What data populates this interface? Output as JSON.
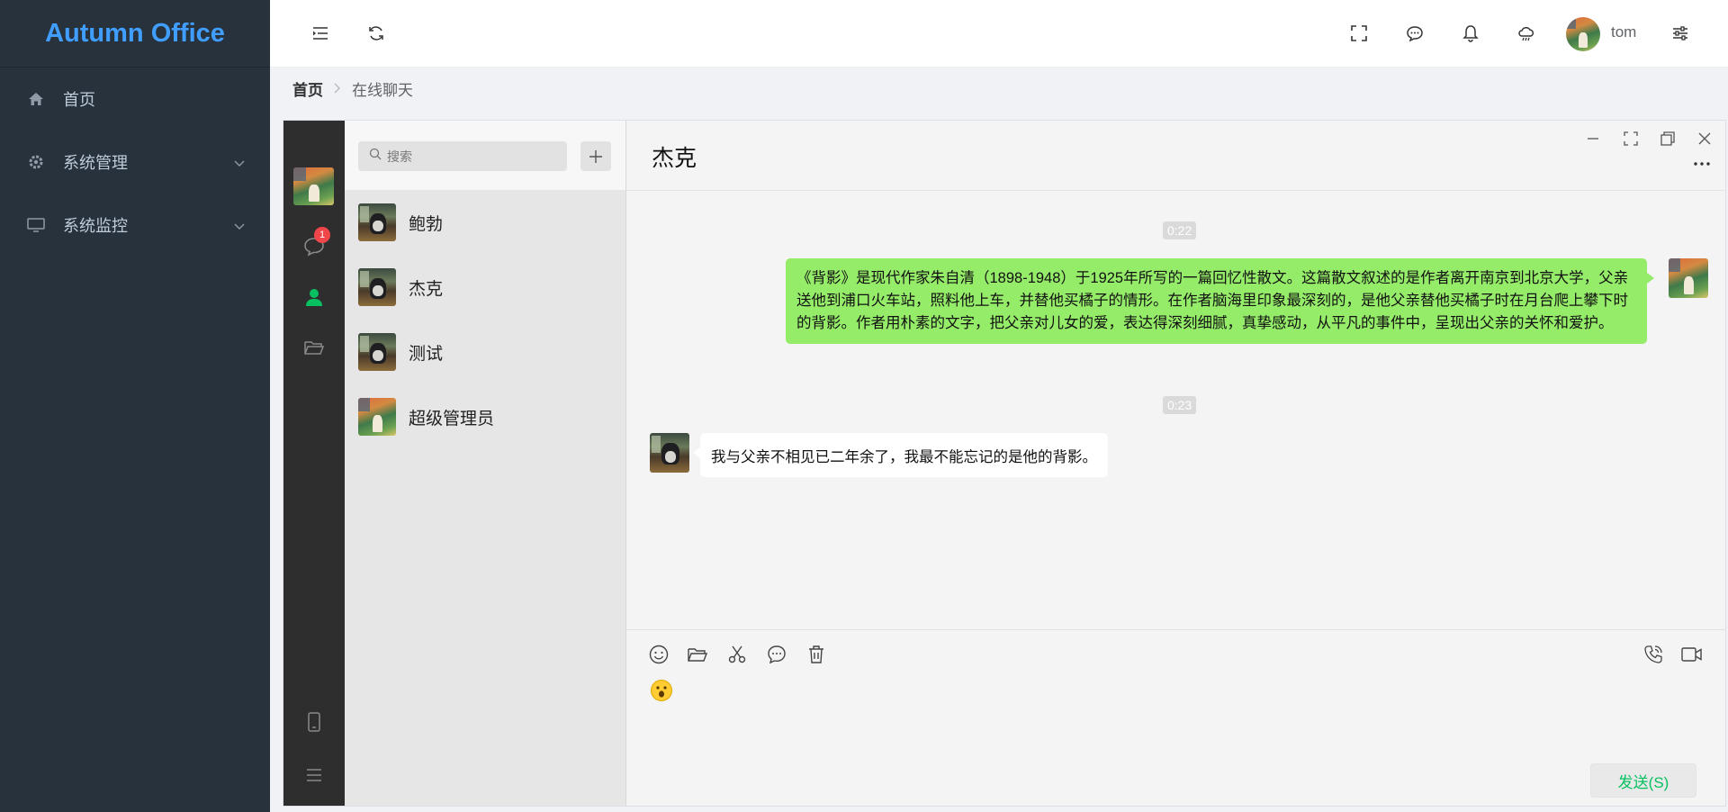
{
  "brand": "Autumn Office",
  "sidebar": {
    "items": [
      {
        "label": "首页",
        "icon": "home-icon"
      },
      {
        "label": "系统管理",
        "icon": "gear-icon",
        "expandable": true
      },
      {
        "label": "系统监控",
        "icon": "monitor-icon",
        "expandable": true
      }
    ]
  },
  "header": {
    "icons": [
      "menu-fold-icon",
      "refresh-icon",
      "fullscreen-icon",
      "message-icon",
      "bell-icon",
      "weather-icon",
      "settings-icon"
    ],
    "user_name": "tom"
  },
  "breadcrumb": {
    "home": "首页",
    "current": "在线聊天"
  },
  "chat": {
    "unread_badge": "1",
    "search_placeholder": "搜索",
    "contacts": [
      {
        "name": "鲍勃",
        "avatar": "cat"
      },
      {
        "name": "杰克",
        "avatar": "cat"
      },
      {
        "name": "测试",
        "avatar": "cat"
      },
      {
        "name": "超级管理员",
        "avatar": "painting"
      }
    ],
    "active_contact": "杰克",
    "messages": [
      {
        "time": "0:22",
        "from": "me",
        "text": "《背影》是现代作家朱自清（1898-1948）于1925年所写的一篇回忆性散文。这篇散文叙述的是作者离开南京到北京大学，父亲送他到浦口火车站，照料他上车，并替他买橘子的情形。在作者脑海里印象最深刻的，是他父亲替他买橘子时在月台爬上攀下时的背影。作者用朴素的文字，把父亲对儿女的爱，表达得深刻细腻，真挚感动，从平凡的事件中，呈现出父亲的关怀和爱护。"
      },
      {
        "time": "0:23",
        "from": "other",
        "text": "我与父亲不相见已二年余了，我最不能忘记的是他的背影。"
      }
    ],
    "input_emoji": "😮",
    "send_label": "发送(S)"
  },
  "colors": {
    "sidebar_bg": "#28323d",
    "brand": "#409eff",
    "my_bubble": "#95ec69",
    "send_text": "#07c160",
    "badge": "#f0464a"
  }
}
